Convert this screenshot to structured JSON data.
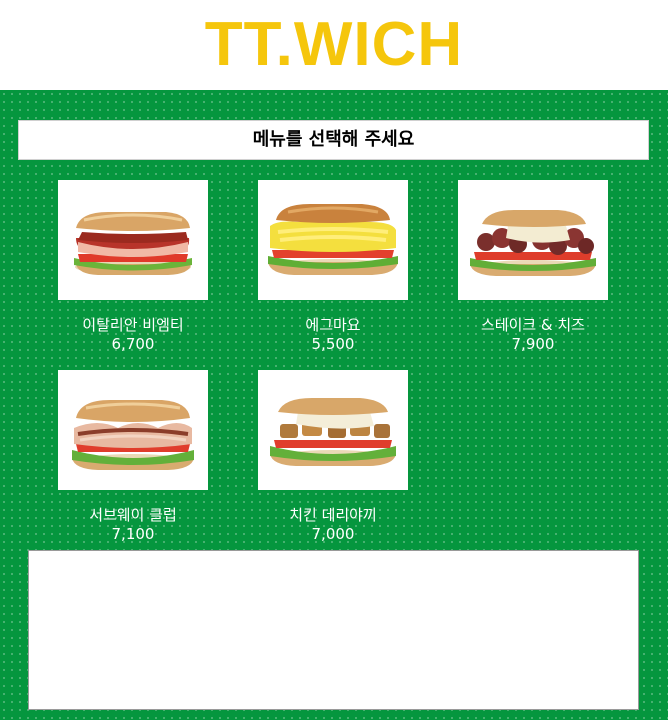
{
  "header": {
    "brand": "TT.WICH"
  },
  "colors": {
    "brand_yellow": "#f5c60c",
    "panel_green": "#05963e"
  },
  "main": {
    "prompt": "메뉴를 선택해 주세요",
    "items": [
      {
        "name": "이탈리안 비엠티",
        "price": "6,700",
        "image": "italian-bmt-sandwich"
      },
      {
        "name": "에그마요",
        "price": "5,500",
        "image": "egg-mayo-sandwich"
      },
      {
        "name": "스테이크 & 치즈",
        "price": "7,900",
        "image": "steak-and-cheese-sandwich"
      },
      {
        "name": "서브웨이 클럽",
        "price": "7,100",
        "image": "subway-club-sandwich"
      },
      {
        "name": "치킨 데리야끼",
        "price": "7,000",
        "image": "chicken-teriyaki-sandwich"
      }
    ],
    "order_output": ""
  }
}
